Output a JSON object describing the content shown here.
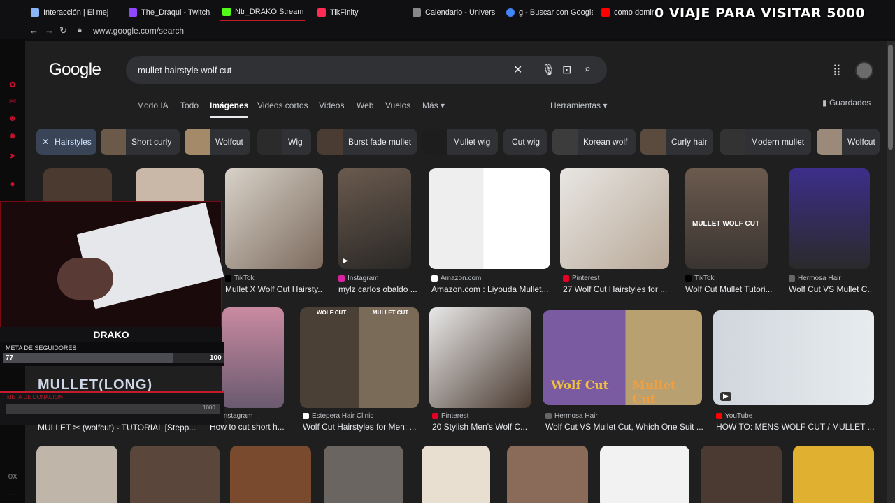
{
  "browser": {
    "tabs": [
      {
        "title": "Interacción | El mej",
        "color": "#8ab4f8"
      },
      {
        "title": "The_Draqui - Twitch",
        "color": "#9146ff"
      },
      {
        "title": "Ntr_DRAKO Stream",
        "color": "#53fc18"
      },
      {
        "title": "TikFinity",
        "color": "#fe2c55"
      },
      {
        "title": "Calendario - Universi",
        "color": "#888888"
      },
      {
        "title": "g - Buscar con Google",
        "color": "#4285f4"
      },
      {
        "title": "como domina",
        "color": "#ff0000"
      }
    ],
    "url": "www.google.com/search",
    "overlay_title": "0  VIAJE PARA VISITAR 5000"
  },
  "google": {
    "logo": "Google",
    "query": "mullet hairstyle wolf cut",
    "tabs": [
      {
        "label": "Modo IA"
      },
      {
        "label": "Todo"
      },
      {
        "label": "Imágenes",
        "selected": true
      },
      {
        "label": "Videos cortos"
      },
      {
        "label": "Videos"
      },
      {
        "label": "Web"
      },
      {
        "label": "Vuelos"
      },
      {
        "label": "Más ▾"
      }
    ],
    "tools_label": "Herramientas ▾",
    "saved_label": "Guardados",
    "chips": [
      {
        "label": "Hairstyles",
        "selected": true
      },
      {
        "label": "Short curly"
      },
      {
        "label": "Wolfcut"
      },
      {
        "label": "Wig"
      },
      {
        "label": "Burst fade mullet"
      },
      {
        "label": "Mullet wig"
      },
      {
        "label": "Cut wig"
      },
      {
        "label": "Korean wolf"
      },
      {
        "label": "Curly hair"
      },
      {
        "label": "Modern mullet"
      },
      {
        "label": "Wolfcut"
      }
    ],
    "results_row1": [
      {
        "source": "TikTok",
        "title": "Mullet X Wolf Cut Hairsty...",
        "fav": "#000000"
      },
      {
        "source": "Instagram",
        "title": "mylz carlos obaldo ...",
        "fav": "#d6249f"
      },
      {
        "source": "Amazon.com",
        "title": "Amazon.com : Liyouda Mullet...",
        "fav": "#ffffff"
      },
      {
        "source": "Pinterest",
        "title": "27 Wolf Cut Hairstyles for ...",
        "fav": "#e60023"
      },
      {
        "source": "TikTok",
        "title": "Wolf Cut Mullet Tutori...",
        "fav": "#000000"
      },
      {
        "source": "Hermosa Hair",
        "title": "Wolf Cut VS Mullet C...",
        "fav": "#666666"
      }
    ],
    "results_row2": [
      {
        "source": "Instagram",
        "title": "How to cut short h...",
        "fav": "#d6249f"
      },
      {
        "source": "Estepera Hair Clinic",
        "title": "Wolf Cut Hairstyles for Men: ...",
        "fav": "#ffffff"
      },
      {
        "source": "Pinterest",
        "title": "20 Stylish Men's Wolf C...",
        "fav": "#e60023"
      },
      {
        "source": "Hermosa Hair",
        "title": "Wolf Cut VS Mullet Cut, Which One Suit ...",
        "fav": "#666666"
      },
      {
        "source": "YouTube",
        "title": "HOW TO: MENS WOLF CUT / MULLET ...",
        "fav": "#ff0000"
      }
    ],
    "image_texts": {
      "mullet_wolf_cut": "MULLET WOLF CUT",
      "wolf_cut": "WOLF CUT",
      "mullet_cut": "MULLET CUT",
      "wolf_cut_script": "Wolf Cut",
      "mullet_cut_script": "Mullet Cut"
    },
    "partial_caption": "MULLET ✂ (wolfcut) - TUTORIAL [Stepp..."
  },
  "stream": {
    "name": "DRAKO",
    "goal_label": "META DE SEGUIDORES",
    "goal_current": "77",
    "goal_max": "100",
    "goal_progress": 0.77,
    "lower_caption": "META DE DONACION",
    "lower_value": "1000",
    "mullet_overlay": "MULLET(LONG)"
  }
}
